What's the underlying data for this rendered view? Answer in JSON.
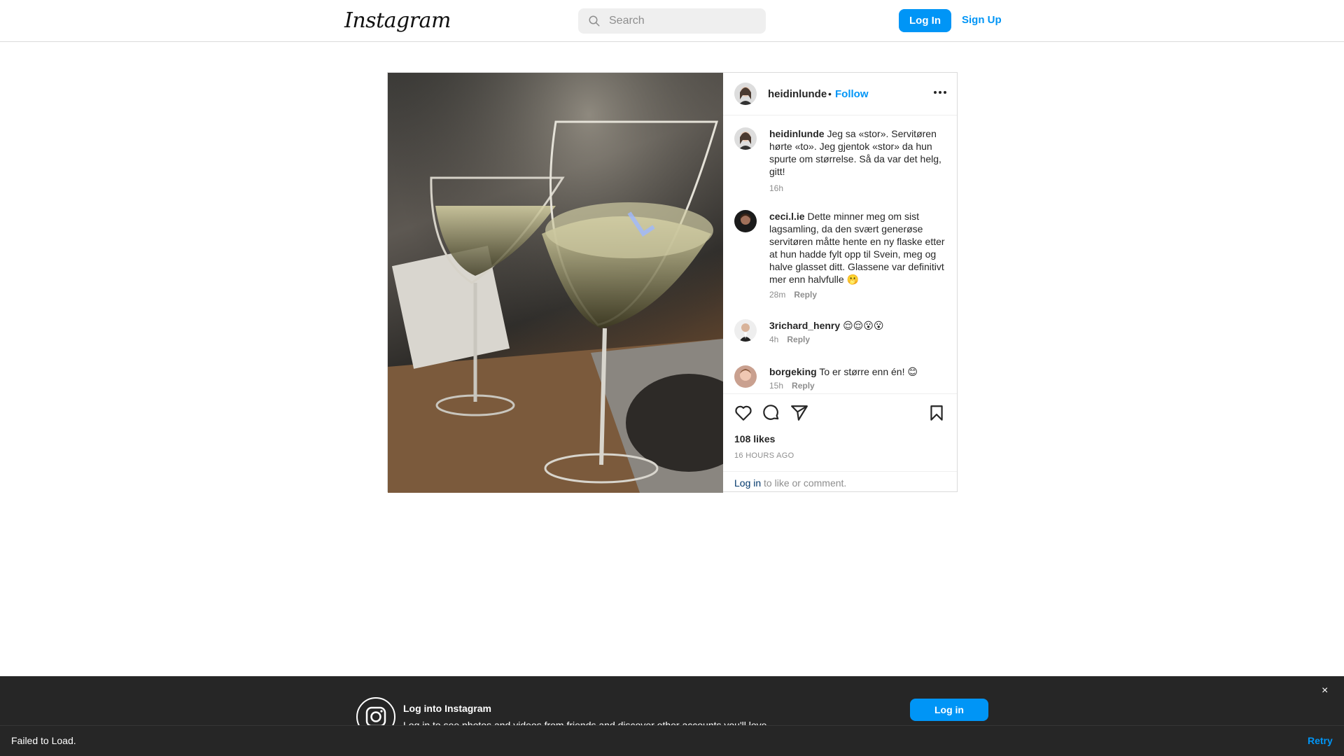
{
  "header": {
    "logo_text": "Instagram",
    "search_placeholder": "Search",
    "login_label": "Log In",
    "signup_label": "Sign Up"
  },
  "post": {
    "author": "heidinlunde",
    "separator": "•",
    "follow_label": "Follow",
    "comments": [
      {
        "user": "heidinlunde",
        "text": "Jeg sa «stor». Servitøren hørte «to». Jeg gjentok «stor» da hun spurte om størrelse. Så da var det helg, gitt!",
        "time": "16h",
        "reply": ""
      },
      {
        "user": "ceci.l.ie",
        "text": "Dette minner meg om sist lagsamling, da den svært generøse servitøren måtte hente en ny flaske etter at hun hadde fylt opp til Svein, meg og halve glasset ditt. Glassene var definitivt mer enn halvfulle 🫢",
        "time": "28m",
        "reply": "Reply"
      },
      {
        "user": "3richard_henry",
        "text": "😌😌😮😮",
        "time": "4h",
        "reply": "Reply"
      },
      {
        "user": "borgeking",
        "text": "To er større enn én! 😊",
        "time": "15h",
        "reply": "Reply"
      }
    ],
    "likes": "108 likes",
    "posted_ago": "16 HOURS AGO",
    "login_link": "Log in",
    "login_suffix": " to like or comment."
  },
  "banner": {
    "title": "Log into Instagram",
    "subtitle": "Log in to see photos and videos from friends and discover other accounts you'll love.",
    "login_button": "Log in",
    "close": "×"
  },
  "toast": {
    "message": "Failed to Load.",
    "retry": "Retry"
  },
  "colors": {
    "accent": "#0095f6",
    "border": "#dbdbdb",
    "muted": "#8e8e8e",
    "banner_bg": "#262626"
  },
  "icons": [
    "search-icon",
    "more-options-icon",
    "heart-icon",
    "comment-icon",
    "share-icon",
    "bookmark-icon",
    "instagram-camera-icon",
    "close-icon"
  ]
}
